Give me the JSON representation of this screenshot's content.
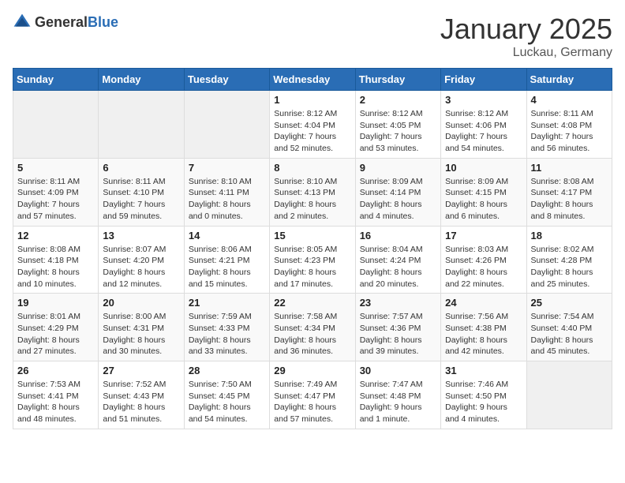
{
  "logo": {
    "general": "General",
    "blue": "Blue"
  },
  "header": {
    "month": "January 2025",
    "location": "Luckau, Germany"
  },
  "weekdays": [
    "Sunday",
    "Monday",
    "Tuesday",
    "Wednesday",
    "Thursday",
    "Friday",
    "Saturday"
  ],
  "weeks": [
    [
      {
        "day": "",
        "info": ""
      },
      {
        "day": "",
        "info": ""
      },
      {
        "day": "",
        "info": ""
      },
      {
        "day": "1",
        "info": "Sunrise: 8:12 AM\nSunset: 4:04 PM\nDaylight: 7 hours and 52 minutes."
      },
      {
        "day": "2",
        "info": "Sunrise: 8:12 AM\nSunset: 4:05 PM\nDaylight: 7 hours and 53 minutes."
      },
      {
        "day": "3",
        "info": "Sunrise: 8:12 AM\nSunset: 4:06 PM\nDaylight: 7 hours and 54 minutes."
      },
      {
        "day": "4",
        "info": "Sunrise: 8:11 AM\nSunset: 4:08 PM\nDaylight: 7 hours and 56 minutes."
      }
    ],
    [
      {
        "day": "5",
        "info": "Sunrise: 8:11 AM\nSunset: 4:09 PM\nDaylight: 7 hours and 57 minutes."
      },
      {
        "day": "6",
        "info": "Sunrise: 8:11 AM\nSunset: 4:10 PM\nDaylight: 7 hours and 59 minutes."
      },
      {
        "day": "7",
        "info": "Sunrise: 8:10 AM\nSunset: 4:11 PM\nDaylight: 8 hours and 0 minutes."
      },
      {
        "day": "8",
        "info": "Sunrise: 8:10 AM\nSunset: 4:13 PM\nDaylight: 8 hours and 2 minutes."
      },
      {
        "day": "9",
        "info": "Sunrise: 8:09 AM\nSunset: 4:14 PM\nDaylight: 8 hours and 4 minutes."
      },
      {
        "day": "10",
        "info": "Sunrise: 8:09 AM\nSunset: 4:15 PM\nDaylight: 8 hours and 6 minutes."
      },
      {
        "day": "11",
        "info": "Sunrise: 8:08 AM\nSunset: 4:17 PM\nDaylight: 8 hours and 8 minutes."
      }
    ],
    [
      {
        "day": "12",
        "info": "Sunrise: 8:08 AM\nSunset: 4:18 PM\nDaylight: 8 hours and 10 minutes."
      },
      {
        "day": "13",
        "info": "Sunrise: 8:07 AM\nSunset: 4:20 PM\nDaylight: 8 hours and 12 minutes."
      },
      {
        "day": "14",
        "info": "Sunrise: 8:06 AM\nSunset: 4:21 PM\nDaylight: 8 hours and 15 minutes."
      },
      {
        "day": "15",
        "info": "Sunrise: 8:05 AM\nSunset: 4:23 PM\nDaylight: 8 hours and 17 minutes."
      },
      {
        "day": "16",
        "info": "Sunrise: 8:04 AM\nSunset: 4:24 PM\nDaylight: 8 hours and 20 minutes."
      },
      {
        "day": "17",
        "info": "Sunrise: 8:03 AM\nSunset: 4:26 PM\nDaylight: 8 hours and 22 minutes."
      },
      {
        "day": "18",
        "info": "Sunrise: 8:02 AM\nSunset: 4:28 PM\nDaylight: 8 hours and 25 minutes."
      }
    ],
    [
      {
        "day": "19",
        "info": "Sunrise: 8:01 AM\nSunset: 4:29 PM\nDaylight: 8 hours and 27 minutes."
      },
      {
        "day": "20",
        "info": "Sunrise: 8:00 AM\nSunset: 4:31 PM\nDaylight: 8 hours and 30 minutes."
      },
      {
        "day": "21",
        "info": "Sunrise: 7:59 AM\nSunset: 4:33 PM\nDaylight: 8 hours and 33 minutes."
      },
      {
        "day": "22",
        "info": "Sunrise: 7:58 AM\nSunset: 4:34 PM\nDaylight: 8 hours and 36 minutes."
      },
      {
        "day": "23",
        "info": "Sunrise: 7:57 AM\nSunset: 4:36 PM\nDaylight: 8 hours and 39 minutes."
      },
      {
        "day": "24",
        "info": "Sunrise: 7:56 AM\nSunset: 4:38 PM\nDaylight: 8 hours and 42 minutes."
      },
      {
        "day": "25",
        "info": "Sunrise: 7:54 AM\nSunset: 4:40 PM\nDaylight: 8 hours and 45 minutes."
      }
    ],
    [
      {
        "day": "26",
        "info": "Sunrise: 7:53 AM\nSunset: 4:41 PM\nDaylight: 8 hours and 48 minutes."
      },
      {
        "day": "27",
        "info": "Sunrise: 7:52 AM\nSunset: 4:43 PM\nDaylight: 8 hours and 51 minutes."
      },
      {
        "day": "28",
        "info": "Sunrise: 7:50 AM\nSunset: 4:45 PM\nDaylight: 8 hours and 54 minutes."
      },
      {
        "day": "29",
        "info": "Sunrise: 7:49 AM\nSunset: 4:47 PM\nDaylight: 8 hours and 57 minutes."
      },
      {
        "day": "30",
        "info": "Sunrise: 7:47 AM\nSunset: 4:48 PM\nDaylight: 9 hours and 1 minute."
      },
      {
        "day": "31",
        "info": "Sunrise: 7:46 AM\nSunset: 4:50 PM\nDaylight: 9 hours and 4 minutes."
      },
      {
        "day": "",
        "info": ""
      }
    ]
  ]
}
